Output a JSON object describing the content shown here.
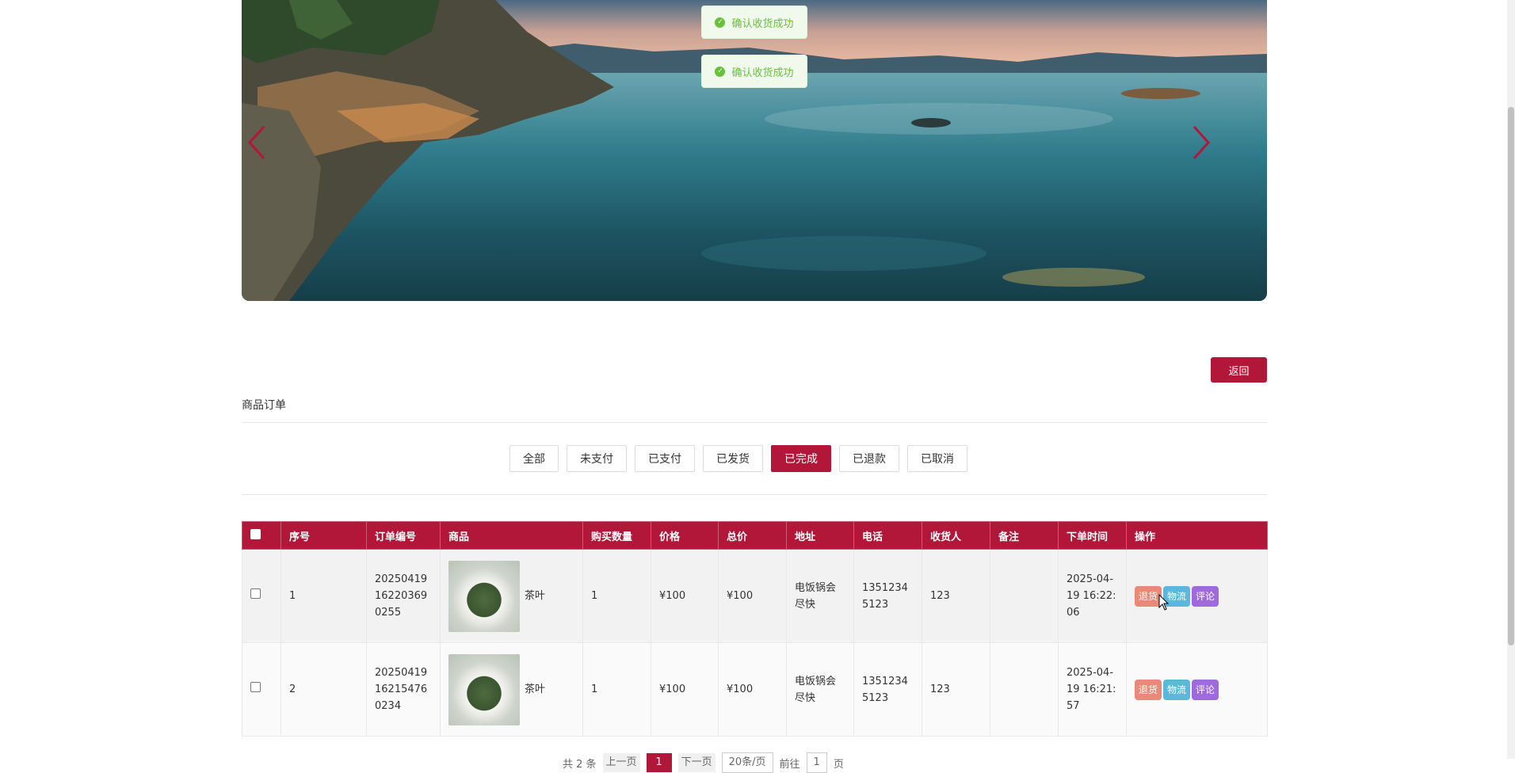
{
  "toasts": [
    {
      "text": "确认收货成功"
    },
    {
      "text": "确认收货成功"
    }
  ],
  "back_label": "返回",
  "section_title": "商品订单",
  "status_tabs": [
    {
      "label": "全部"
    },
    {
      "label": "未支付"
    },
    {
      "label": "已支付"
    },
    {
      "label": "已发货"
    },
    {
      "label": "已完成",
      "active": true
    },
    {
      "label": "已退款"
    },
    {
      "label": "已取消"
    }
  ],
  "table": {
    "headers": [
      "序号",
      "订单编号",
      "商品",
      "购买数量",
      "价格",
      "总价",
      "地址",
      "电话",
      "收货人",
      "备注",
      "下单时间",
      "操作"
    ],
    "rows": [
      {
        "index": "1",
        "order_no": "20250419162203690255",
        "product": "茶叶",
        "qty": "1",
        "price": "¥100",
        "total": "¥100",
        "address": "电饭锅会尽快",
        "phone": "13512345123",
        "receiver": "123",
        "remark": "",
        "time": "2025-04-19 16:22:06"
      },
      {
        "index": "2",
        "order_no": "20250419162154760234",
        "product": "茶叶",
        "qty": "1",
        "price": "¥100",
        "total": "¥100",
        "address": "电饭锅会尽快",
        "phone": "13512345123",
        "receiver": "123",
        "remark": "",
        "time": "2025-04-19 16:21:57"
      }
    ],
    "actions": {
      "return": "退货",
      "logistics": "物流",
      "comment": "评论"
    }
  },
  "pagination": {
    "total": "共 2 条",
    "prev": "上一页",
    "current": "1",
    "next": "下一页",
    "page_size": "20条/页",
    "goto": "前往",
    "goto_value": "1",
    "page_unit": "页"
  },
  "colors": {
    "accent": "#b2173a",
    "success": "#67c23a",
    "return": "#e8897a",
    "logistics": "#5bb8d9",
    "comment": "#9f6bdc"
  }
}
